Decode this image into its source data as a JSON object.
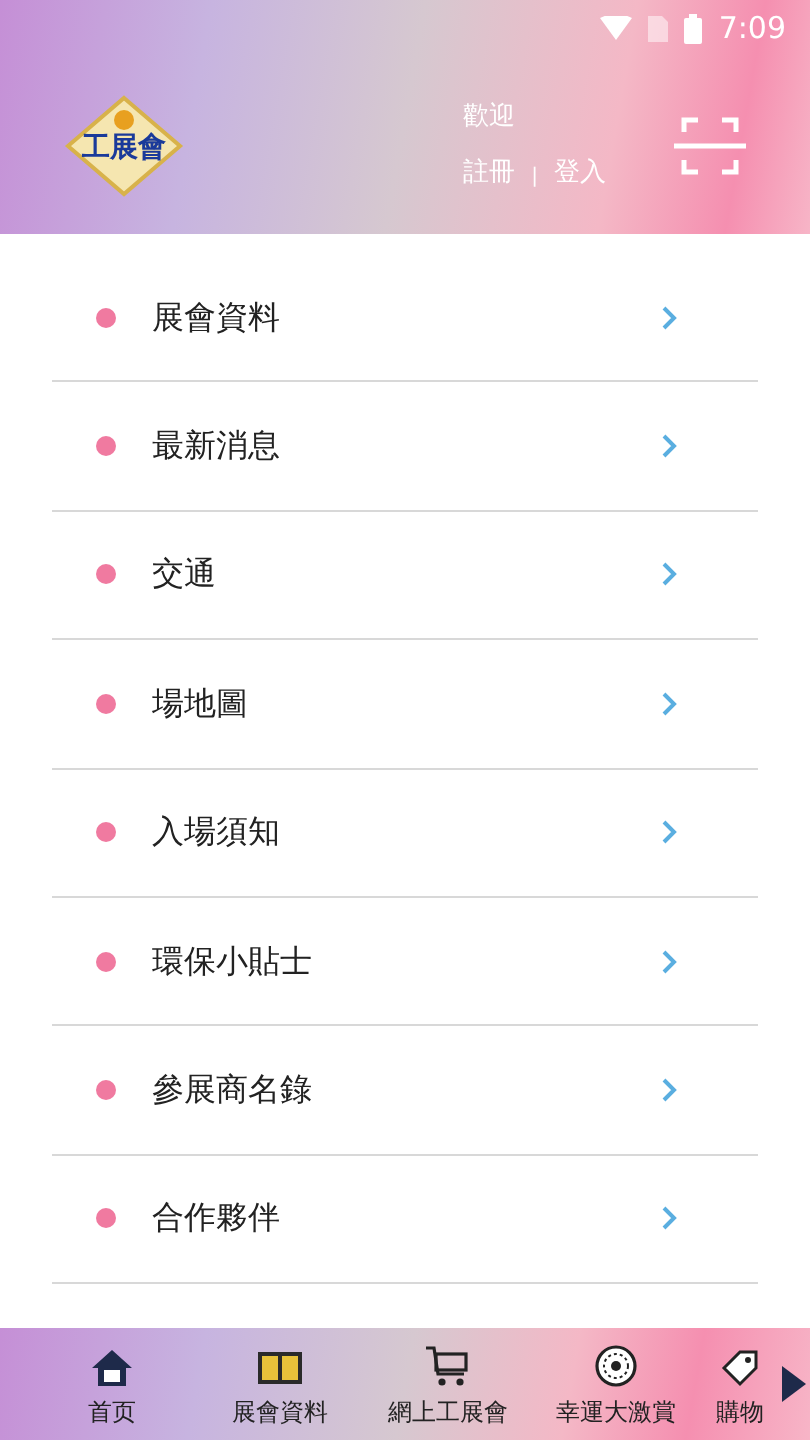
{
  "status_bar": {
    "time": "7:09"
  },
  "header": {
    "logo_text": "工展會",
    "welcome": "歡迎",
    "register": "註冊",
    "separator": "|",
    "login": "登入"
  },
  "menu": [
    {
      "label": "展會資料"
    },
    {
      "label": "最新消息"
    },
    {
      "label": "交通"
    },
    {
      "label": "場地圖"
    },
    {
      "label": "入場須知"
    },
    {
      "label": "環保小貼士"
    },
    {
      "label": "參展商名錄"
    },
    {
      "label": "合作夥伴"
    }
  ],
  "bottom_nav": [
    {
      "label": "首页",
      "kind": "home"
    },
    {
      "label": "展會資料",
      "kind": "book"
    },
    {
      "label": "網上工展會",
      "kind": "cart"
    },
    {
      "label": "幸運大激賞",
      "kind": "wheel"
    },
    {
      "label": "購物",
      "kind": "tag"
    }
  ]
}
